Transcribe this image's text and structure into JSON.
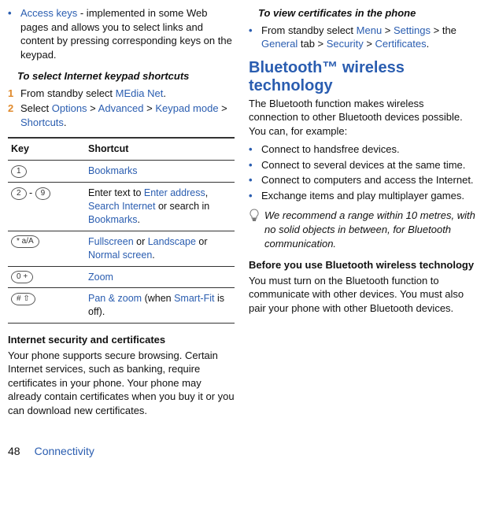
{
  "left": {
    "accessKeysTerm": "Access keys",
    "accessKeysDesc": " - implemented in some Web pages and allows you to select links and content by pressing corresponding keys on the keypad.",
    "subhead1": "To select Internet keypad shortcuts",
    "step1a": "From standby select ",
    "step1Link": "MEdia Net",
    "step1b": ".",
    "step2a": "Select ",
    "step2L1": "Options",
    "step2L2": "Advanced",
    "step2L3": "Keypad mode",
    "step2L4": "Shortcuts",
    "tableHeadKey": "Key",
    "tableHeadShortcut": "Shortcut",
    "rows": [
      {
        "keyLabel": "1",
        "cellParts": [
          {
            "t": "Bookmarks",
            "link": true
          }
        ]
      },
      {
        "keyLabel": "2",
        "keySep": " - ",
        "keyLabel2": "9",
        "cellParts": [
          {
            "t": "Enter text to "
          },
          {
            "t": "Enter address",
            "link": true
          },
          {
            "t": ", "
          },
          {
            "t": "Search Internet",
            "link": true
          },
          {
            "t": " or search in "
          },
          {
            "t": "Bookmarks",
            "link": true
          },
          {
            "t": "."
          }
        ]
      },
      {
        "keyLabel": "* a/A",
        "cellParts": [
          {
            "t": "Fullscreen",
            "link": true
          },
          {
            "t": " or "
          },
          {
            "t": "Landscape",
            "link": true
          },
          {
            "t": " or "
          },
          {
            "t": "Normal screen",
            "link": true
          },
          {
            "t": "."
          }
        ]
      },
      {
        "keyLabel": "0 +",
        "cellParts": [
          {
            "t": "Zoom",
            "link": true
          }
        ]
      },
      {
        "keyLabel": "# ⇧",
        "cellParts": [
          {
            "t": "Pan & zoom",
            "link": true
          },
          {
            "t": " (when "
          },
          {
            "t": "Smart-Fit",
            "link": true
          },
          {
            "t": " is off)."
          }
        ]
      }
    ],
    "certHead": "Internet security and certificates",
    "certBody": "Your phone supports secure browsing. Certain Internet services, such as banking, require certificates in your phone. Your phone may already contain certificates when you buy it or you can download new certificates."
  },
  "right": {
    "subhead1": "To view certificates in the phone",
    "step1a": "From standby select ",
    "l1": "Menu",
    "l2": "Settings",
    "l3mid": " the ",
    "l3": "General",
    "l3tab": " tab > ",
    "l4": "Security",
    "l5": "Certificates",
    "btHead": "Bluetooth™ wireless technology",
    "btIntro": "The Bluetooth function makes wireless connection to other Bluetooth devices possible. You can, for example:",
    "bullets": [
      "Connect to handsfree devices.",
      "Connect to several devices at the same time.",
      "Connect to computers and access the Internet.",
      "Exchange items and play multiplayer games."
    ],
    "note": "We recommend a range within 10 metres, with no solid objects in between, for Bluetooth communication.",
    "beforeHead": "Before you use Bluetooth wireless technology",
    "beforeBody": "You must turn on the Bluetooth function to communicate with other devices. You must also pair your phone with other Bluetooth devices."
  },
  "footer": {
    "page": "48",
    "section": "Connectivity"
  }
}
